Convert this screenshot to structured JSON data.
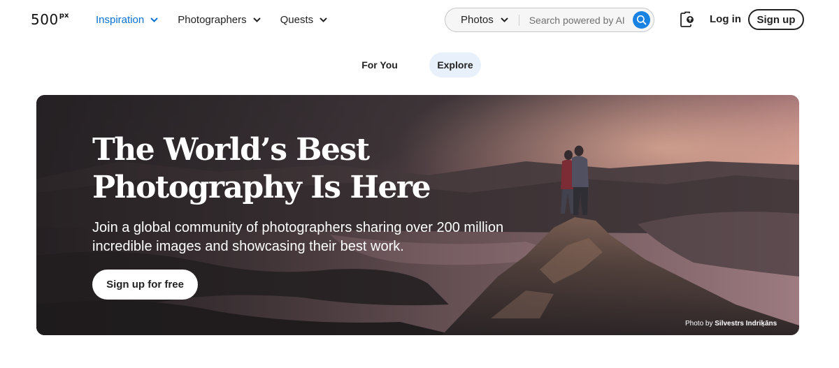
{
  "header": {
    "logo": {
      "main": "500",
      "superscript": "px"
    },
    "nav": [
      {
        "label": "Inspiration",
        "active": true,
        "icon": "chevron-down-icon"
      },
      {
        "label": "Photographers",
        "active": false,
        "icon": "chevron-down-icon"
      },
      {
        "label": "Quests",
        "active": false,
        "icon": "chevron-down-icon"
      }
    ],
    "search": {
      "type_label": "Photos",
      "placeholder": "Search powered by AI",
      "value": "",
      "button_icon": "search-icon"
    },
    "upload_icon": "upload-icon",
    "login_label": "Log in",
    "signup_label": "Sign up"
  },
  "tabs": [
    {
      "label": "For You",
      "active": false
    },
    {
      "label": "Explore",
      "active": true
    }
  ],
  "hero": {
    "title_line1": "The World’s Best",
    "title_line2": "Photography Is Here",
    "subtitle": "Join a global community of photographers sharing over 200 million incredible images and showcasing their best work.",
    "cta_label": "Sign up for free",
    "credit_prefix": "Photo by",
    "credit_name": "Silvestrs Indriķāns"
  },
  "colors": {
    "accent": "#0870d1",
    "search_button": "#1a82e2",
    "active_tab_bg": "#e8f1fb",
    "text": "#222222"
  }
}
